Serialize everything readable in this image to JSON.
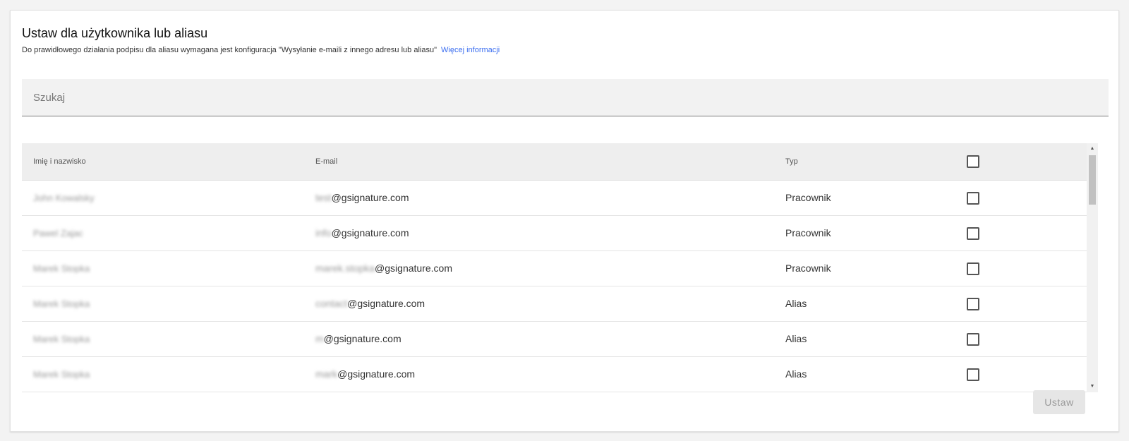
{
  "header": {
    "title": "Ustaw dla użytkownika lub aliasu",
    "subtitle": "Do prawidłowego działania podpisu dla aliasu wymagana jest konfiguracja \"Wysyłanie e-maili z innego adresu lub aliasu\"",
    "more_link": "Więcej informacji"
  },
  "search": {
    "placeholder": "Szukaj",
    "value": ""
  },
  "table": {
    "columns": {
      "name": "Imię i nazwisko",
      "email": "E-mail",
      "type": "Typ"
    },
    "rows": [
      {
        "name": "John Kowalsky",
        "email_local": "test",
        "email_domain": "@gsignature.com",
        "type": "Pracownik",
        "checked": false
      },
      {
        "name": "Pawel Zajac",
        "email_local": "info",
        "email_domain": "@gsignature.com",
        "type": "Pracownik",
        "checked": false
      },
      {
        "name": "Marek Stopka",
        "email_local": "marek.stopka",
        "email_domain": "@gsignature.com",
        "type": "Pracownik",
        "checked": false
      },
      {
        "name": "Marek Stopka",
        "email_local": "contact",
        "email_domain": "@gsignature.com",
        "type": "Alias",
        "checked": false
      },
      {
        "name": "Marek Stopka",
        "email_local": "m",
        "email_domain": "@gsignature.com",
        "type": "Alias",
        "checked": false
      },
      {
        "name": "Marek Stopka",
        "email_local": "mark",
        "email_domain": "@gsignature.com",
        "type": "Alias",
        "checked": false
      }
    ]
  },
  "actions": {
    "submit_label": "Ustaw"
  },
  "icons": {
    "scroll_up": "triangle-up-icon",
    "scroll_down": "triangle-down-icon"
  },
  "colors": {
    "link": "#3b6ef0",
    "header_bg": "#eeeeee",
    "search_bg": "#f2f2f2"
  }
}
